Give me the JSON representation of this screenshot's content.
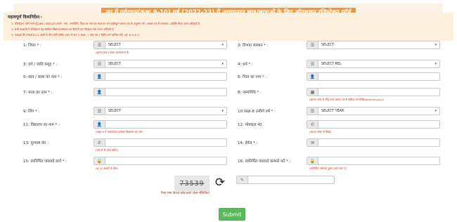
{
  "header": {
    "title": "उप्र में पूर्वदशम(कक्षा 9-10) वर्ष (2022-23) में अध्ययनरत छात्र/छात्राओं के लिए ऑनलाइन रजिस्ट्रेशन फॉर्म"
  },
  "instructions": {
    "heading": "महत्वपूर्ण दिशानिर्देश:-",
    "lines": [
      "1. रजिस्ट्रेशन फॉर्म भरने हेतु छात्र / छात्रा द्वारा अपने : नाम, जन्मतिथि, पिता का नाम एवं माता का नाम हाईस्कूल प्रमाण-पत्र के अनुसार भरें / आधार पत्र में नामांकन / प्रविष्टि किया जाना अनिवार्य है",
      "2. सभी कक्षाओं में रजिस्ट्रेशन हेतु संबंधित विद्यालय/संस्थान का कैटेगरी एवं मोबाइल नंबर भरना अनिवार्य है",
      "3. पासवर्ड की लम्बाई 6-12 अंकों के बीच होनी चाहिए (कम से कम 1 अक्षर, 1 अंक एवं 1 विशेष वर्ण शामिल करें) (@ # $ & !)"
    ]
  },
  "fields": {
    "district": {
      "label": "1: जिला * :",
      "value": "SELECT",
      "hint": "(कृपया छात्र / छात्रा अध्ययनरत है)"
    },
    "department": {
      "label": "2: विभाग संस्थान * :",
      "value": "SELECT"
    },
    "category": {
      "label": "3: वर्ग / जाति समूह * :",
      "value": "SELECT"
    },
    "religion": {
      "label": "4: धर्म * :",
      "value": "SELECT REL"
    },
    "student_name": {
      "label": "5: छात्र / छात्रा का नाम * :",
      "value": ""
    },
    "father_name": {
      "label": "6: पिता का नाम * :",
      "value": ""
    },
    "mother_name": {
      "label": "7: माता का नाम * :",
      "value": ""
    },
    "dob": {
      "label": "8: जन्मतिथि * :",
      "value": "",
      "hint": "(कृपया जन्म के लिए उच्च प्रमाण पत्र से अंकित जन्मतिथि(dd/mm/yyyy))"
    },
    "gender": {
      "label": "9: लिंग * :",
      "value": "SELECT"
    },
    "year": {
      "label": "10:कक्षा-8 उत्तीर्ण वर्ष * :",
      "value": "SELECT YEAR"
    },
    "school_name": {
      "label": "11: विद्यालय का नाम * :",
      "value": "",
      "hint": "(कक्षा-9 में अध्ययनरत वर्तमान विद्यालय का नाम)"
    },
    "mobile": {
      "label": "12: मोबाइल नं0",
      "value": "",
      "hint": "(अपना नम्बर से लिखें)"
    },
    "phone": {
      "label": "13: दूरभाष नं0 :",
      "value": "",
      "hint": "(एस टी डी कोड सहित)"
    },
    "email": {
      "label": "14: ईमेल * :",
      "value": ""
    },
    "password": {
      "label": "15: स्वनिर्मित पासवर्ड डालें * :",
      "value": "",
      "hint": "(6-12 अक्षरों के बीच)"
    },
    "confirm_password": {
      "label": "16: स्वनिर्मित पासवर्ड कन्फर्म करें * :",
      "value": "",
      "hint": "(स्वनिर्मित पासवर्ड दुबारा डालें ध्यान दें)"
    }
  },
  "captcha": {
    "code": "73539",
    "input_value": "",
    "hint": "दिया गया कैप्चा कोड डालें (केस सेंसिटिव)"
  },
  "submit_label": "Submit",
  "colors": {
    "title_bg": "#f0963c",
    "instructions_bg": "#fdf0dc",
    "hint": "#c03020",
    "submit": "#5cb85c"
  },
  "icons": {
    "select": "list-icon",
    "text": "user-icon",
    "date": "calendar-icon",
    "phone": "phone-icon",
    "email": "envelope-icon",
    "password": "lock-icon",
    "captcha": "pencil-icon"
  }
}
